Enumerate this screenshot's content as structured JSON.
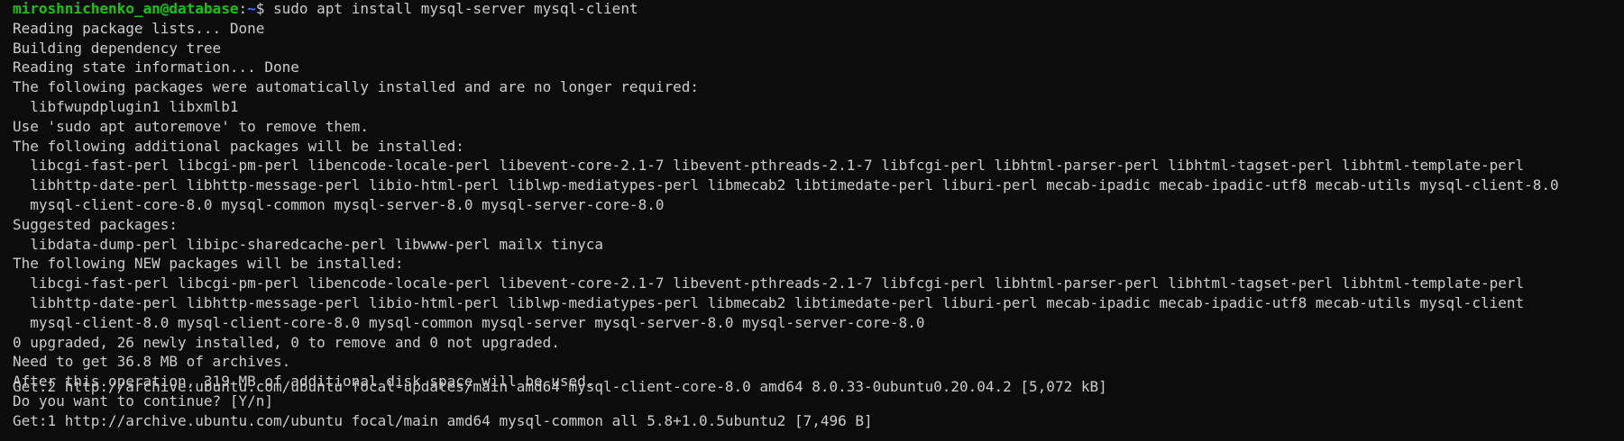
{
  "prompt": {
    "user_host": "miroshnichenko_an@database",
    "separator": ":",
    "path": "~",
    "symbol": "$ ",
    "command": "sudo apt install mysql-server mysql-client"
  },
  "output_lines": [
    "Reading package lists... Done",
    "Building dependency tree",
    "Reading state information... Done",
    "The following packages were automatically installed and are no longer required:",
    "  libfwupdplugin1 libxmlb1",
    "Use 'sudo apt autoremove' to remove them.",
    "The following additional packages will be installed:",
    "  libcgi-fast-perl libcgi-pm-perl libencode-locale-perl libevent-core-2.1-7 libevent-pthreads-2.1-7 libfcgi-perl libhtml-parser-perl libhtml-tagset-perl libhtml-template-perl",
    "  libhttp-date-perl libhttp-message-perl libio-html-perl liblwp-mediatypes-perl libmecab2 libtimedate-perl liburi-perl mecab-ipadic mecab-ipadic-utf8 mecab-utils mysql-client-8.0",
    "  mysql-client-core-8.0 mysql-common mysql-server-8.0 mysql-server-core-8.0",
    "Suggested packages:",
    "  libdata-dump-perl libipc-sharedcache-perl libwww-perl mailx tinyca",
    "The following NEW packages will be installed:",
    "  libcgi-fast-perl libcgi-pm-perl libencode-locale-perl libevent-core-2.1-7 libevent-pthreads-2.1-7 libfcgi-perl libhtml-parser-perl libhtml-tagset-perl libhtml-template-perl",
    "  libhttp-date-perl libhttp-message-perl libio-html-perl liblwp-mediatypes-perl libmecab2 libtimedate-perl liburi-perl mecab-ipadic mecab-ipadic-utf8 mecab-utils mysql-client",
    "  mysql-client-8.0 mysql-client-core-8.0 mysql-common mysql-server mysql-server-8.0 mysql-server-core-8.0",
    "0 upgraded, 26 newly installed, 0 to remove and 0 not upgraded.",
    "Need to get 36.8 MB of archives.",
    "After this operation, 319 MB of additional disk space will be used.",
    "Do you want to continue? [Y/n]",
    "Get:1 http://archive.ubuntu.com/ubuntu focal/main amd64 mysql-common all 5.8+1.0.5ubuntu2 [7,496 B]"
  ],
  "partial_line": "Get:2 http://archive.ubuntu.com/ubuntu focal-updates/main amd64 mysql-client-core-8.0 amd64 8.0.33-0ubuntu0.20.04.2 [5,072 kB]",
  "colors": {
    "background": "#0c0c0c",
    "text": "#cccccc",
    "prompt_user": "#16c60c",
    "prompt_path": "#3b78ff"
  }
}
